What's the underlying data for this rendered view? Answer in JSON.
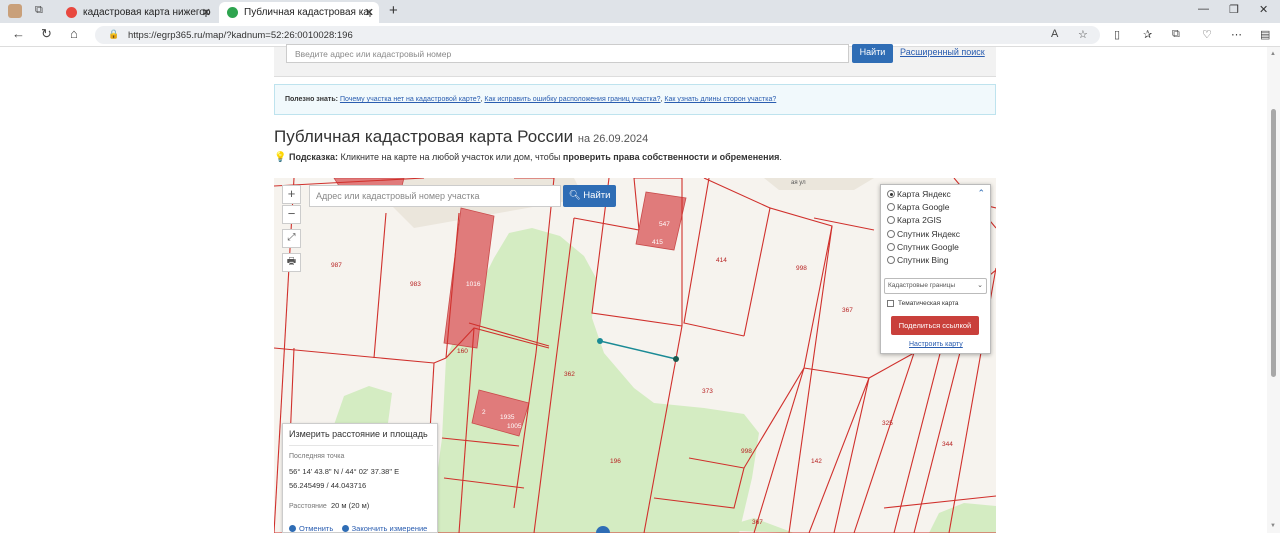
{
  "browser": {
    "tabs": [
      {
        "title": "кадастровая карта нижегородс",
        "favicon_color": "#e8483f"
      },
      {
        "title": "Публичная кадастровая карта -",
        "favicon_color": "#2ea44f",
        "active": true
      }
    ],
    "url": "https://egrp365.ru/map/?kadnum=52:26:0010028:196"
  },
  "search": {
    "placeholder": "Введите адрес или кадастровый номер",
    "button": "Найти",
    "advanced_link": "Расширенный поиск"
  },
  "info": {
    "prefix": "Полезно знать:",
    "links": [
      "Почему участка нет на кадастровой карте?",
      "Как исправить ошибку расположения границ участка?",
      "Как узнать длины сторон участка?"
    ]
  },
  "page": {
    "title": "Публичная кадастровая карта России",
    "date": "на 26.09.2024",
    "hint_label": "Подсказка:",
    "hint_text": "Кликните на карте на любой участок или дом, чтобы",
    "hint_bold": "проверить права собственности и обременения",
    "hint_end": "."
  },
  "map": {
    "zoom_in": "+",
    "zoom_out": "−",
    "search_placeholder": "Адрес или кадастровый номер участка",
    "search_button": "Найти",
    "road_label": "ая ул",
    "parcel_labels": [
      "987",
      "983",
      "1016",
      "160",
      "547",
      "415",
      "414",
      "998",
      "367",
      "362",
      "373",
      "2",
      "1935",
      "1005",
      "196",
      "998",
      "142",
      "325",
      "344",
      "367"
    ]
  },
  "layers": {
    "options": [
      "Карта Яндекс",
      "Карта Google",
      "Карта 2GIS",
      "Спутник Яндекс",
      "Спутник Google",
      "Спутник Bing"
    ],
    "selected_index": 0,
    "overlay": "Кадастровые границы",
    "thematic": "Тематическая карта",
    "share": "Поделиться ссылкой",
    "setup": "Настроить карту"
  },
  "measure": {
    "title": "Измерить расстояние и площадь",
    "last_point_label": "Последняя точка",
    "coords_dms": "56° 14' 43.8\" N / 44° 02' 37.38\" E",
    "coords_dec": "56.245499 / 44.043716",
    "distance_label": "Расстояние",
    "distance": "20 м (20 м)",
    "cancel": "Отменить",
    "finish": "Закончить измерение"
  },
  "colors": {
    "parcel_border": "#d0302c",
    "building": "#e07b7b",
    "greenery": "#d4ecc2",
    "accent": "#2f6db5"
  }
}
